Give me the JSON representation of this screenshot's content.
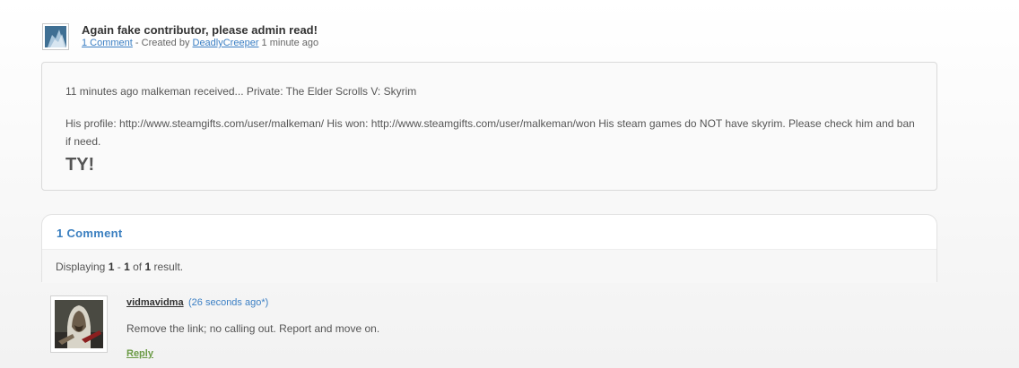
{
  "thread": {
    "title": "Again fake contributor, please admin read!",
    "comment_link": "1 Comment",
    "created_by_text": " - Created by ",
    "author": "DeadlyCreeper",
    "time_text": " 1 minute ago"
  },
  "post": {
    "line1": "11 minutes ago malkeman received... Private: The Elder Scrolls V: Skyrim",
    "line2": "His profile: http://www.steamgifts.com/user/malkeman/ His won: http://www.steamgifts.com/user/malkeman/won His steam games do NOT have skyrim. Please check him and ban if need.",
    "emphasis": "TY!"
  },
  "comments": {
    "header": "1 Comment",
    "display_prefix": "Displaying ",
    "range_start": "1",
    "range_sep": " - ",
    "range_end": "1",
    "of_text": " of ",
    "total": "1",
    "suffix": " result."
  },
  "comment": {
    "author": "vidmavidma",
    "time": "(26 seconds ago*)",
    "text": "Remove the link; no calling out. Report and move on.",
    "reply_label": "Reply"
  },
  "colors": {
    "link": "#2c6fb3",
    "comments_header": "#3a7fc0",
    "reply": "#6a9a44"
  },
  "icons": {
    "thread_avatar": "user-avatar-icon",
    "comment_avatar": "assassin-avatar-icon"
  }
}
